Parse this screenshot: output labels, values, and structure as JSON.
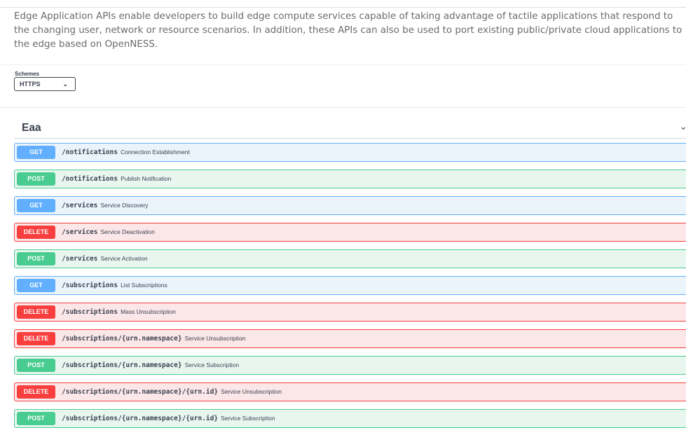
{
  "description": [
    "Edge Application APIs enable developers to build edge compute services capable of taking advantage of tactile applications that respond to",
    "the changing user, network or resource scenarios. In addition, these APIs can also be used to port existing public/private cloud applications to",
    "the edge based on OpenNESS."
  ],
  "schemes": {
    "label": "Schemes",
    "selected": "HTTPS",
    "chevron_icon": "chevron-down-icon"
  },
  "tag": {
    "title": "Eaa",
    "chevron_icon": "chevron-down-icon"
  },
  "method_colors": {
    "GET": "#61affe",
    "POST": "#49cc90",
    "DELETE": "#f93e3e"
  },
  "operations": [
    {
      "method": "GET",
      "path": "/notifications",
      "summary": "Connection Establishment"
    },
    {
      "method": "POST",
      "path": "/notifications",
      "summary": "Publish Notification"
    },
    {
      "method": "GET",
      "path": "/services",
      "summary": "Service Discovery"
    },
    {
      "method": "DELETE",
      "path": "/services",
      "summary": "Service Deactivation"
    },
    {
      "method": "POST",
      "path": "/services",
      "summary": "Service Activation"
    },
    {
      "method": "GET",
      "path": "/subscriptions",
      "summary": "List Subscriptions"
    },
    {
      "method": "DELETE",
      "path": "/subscriptions",
      "summary": "Mass Unsubscription"
    },
    {
      "method": "DELETE",
      "path": "/subscriptions/{urn.namespace}",
      "summary": "Service Unsubscription"
    },
    {
      "method": "POST",
      "path": "/subscriptions/{urn.namespace}",
      "summary": "Service Subscription"
    },
    {
      "method": "DELETE",
      "path": "/subscriptions/{urn.namespace}/{urn.id}",
      "summary": "Service Unsubscription"
    },
    {
      "method": "POST",
      "path": "/subscriptions/{urn.namespace}/{urn.id}",
      "summary": "Service Subscription"
    }
  ]
}
